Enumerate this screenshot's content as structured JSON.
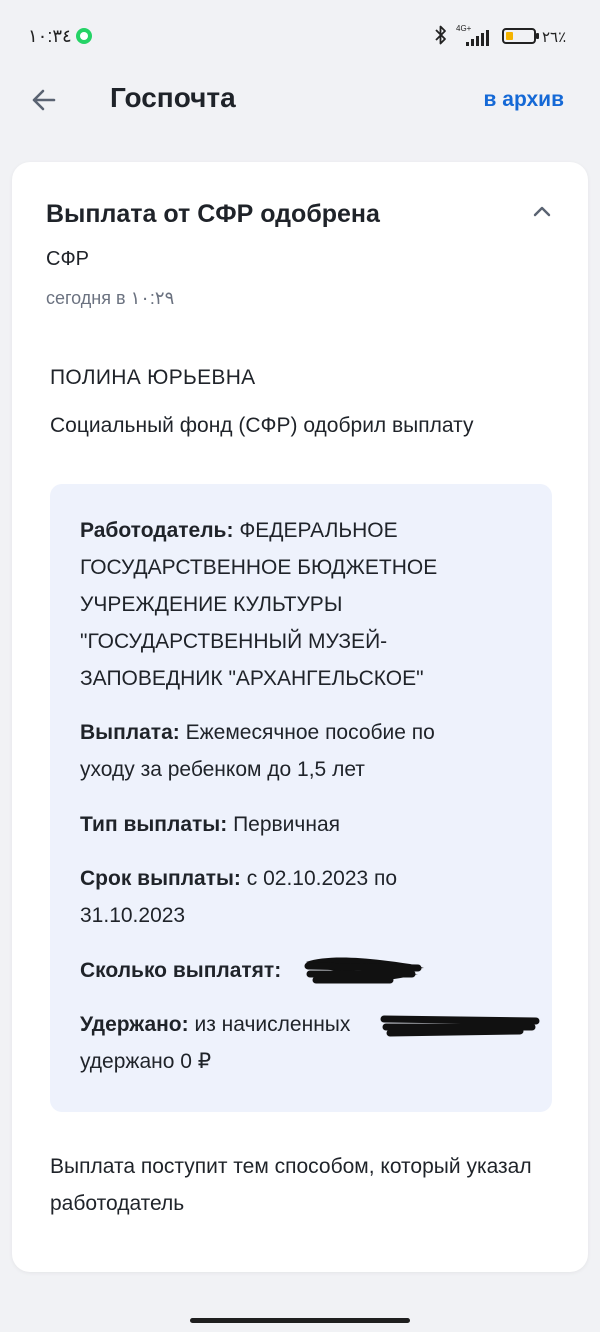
{
  "status_bar": {
    "time": "١٠:٣٤",
    "network": "4G+",
    "battery_percent": "٢٦٪",
    "battery_level": 0.26
  },
  "header": {
    "title": "Госпочта",
    "archive_label": "в архив"
  },
  "message": {
    "title": "Выплата от СФР одобрена",
    "sender": "СФР",
    "time": "сегодня в ١٠:٢٩",
    "recipient": "ПОЛИНА ЮРЬЕВНА",
    "intro": "Социальный фонд (СФР) одобрил выплату",
    "details": {
      "employer_label": "Работодатель:",
      "employer_value": "ФЕДЕРАЛЬНОЕ ГОСУДАРСТВЕННОЕ БЮДЖЕТНОЕ УЧРЕЖДЕНИЕ КУЛЬТУРЫ \"ГОСУДАРСТВЕННЫЙ МУЗЕЙ-ЗАПОВЕДНИК \"АРХАНГЕЛЬСКОЕ\"",
      "payment_label": "Выплата:",
      "payment_value": "Ежемесячное пособие по уходу за ребенком до 1,5 лет",
      "type_label": "Тип выплаты:",
      "type_value": "Первичная",
      "term_label": "Срок выплаты:",
      "term_value": "с 02.10.2023 по 31.10.2023",
      "amount_label": "Сколько выплатят:",
      "withheld_label": "Удержано:",
      "withheld_prefix": "из начисленных",
      "withheld_suffix": "удержано 0 ₽"
    },
    "footer": "Выплата поступит тем способом, который указал работодатель"
  },
  "colors": {
    "accent": "#1569d6",
    "details_background": "#eef2fc",
    "page_background": "#f1f2f5"
  }
}
